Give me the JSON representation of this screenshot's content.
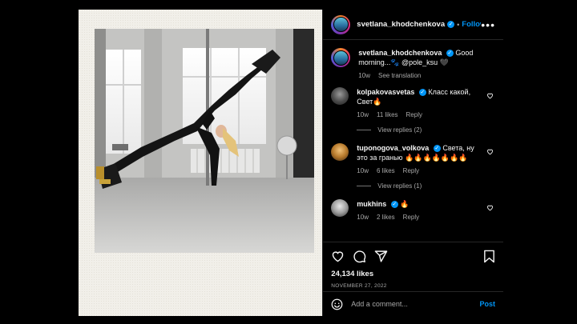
{
  "post": {
    "username": "svetlana_khodchenkova",
    "follow_label": "Follow",
    "more_label": "•••",
    "caption": "Good morning...🐾 @pole_ksu 🖤",
    "caption_time": "10w",
    "see_translation": "See translation"
  },
  "comments": [
    {
      "username": "kolpakovasvetas",
      "verified": true,
      "text": "Класс какой, Свет🔥",
      "time": "10w",
      "likes": "11 likes",
      "reply_label": "Reply",
      "view_replies": "View replies (2)"
    },
    {
      "username": "tuponogova_volkova",
      "verified": true,
      "text": "Света, ну это за гранью 🔥🔥🔥🔥🔥🔥🔥",
      "time": "10w",
      "likes": "6 likes",
      "reply_label": "Reply",
      "view_replies": "View replies (1)"
    },
    {
      "username": "mukhins",
      "verified": true,
      "text": "🔥",
      "time": "10w",
      "likes": "2 likes",
      "reply_label": "Reply"
    }
  ],
  "footer": {
    "likes": "24,134 likes",
    "date": "NOVEMBER 27, 2022",
    "comment_placeholder": "Add a comment...",
    "post_label": "Post"
  },
  "icons": {
    "like": "heart-icon",
    "comment": "comment-icon",
    "share": "share-icon",
    "save": "bookmark-icon",
    "emoji": "emoji-icon"
  },
  "colors": {
    "background": "#000000",
    "accent": "#0095f6",
    "text": "#f5f5f5",
    "muted": "#a8a8a8",
    "divider": "#262626"
  }
}
